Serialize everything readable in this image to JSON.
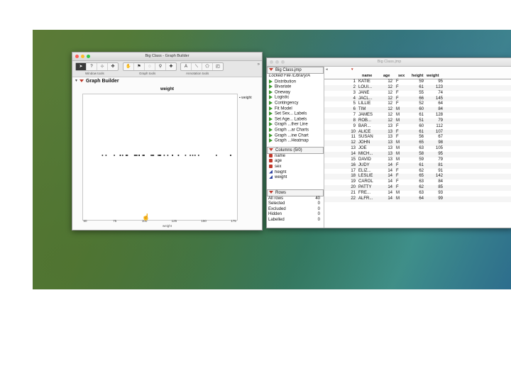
{
  "graph_window": {
    "title": "Big Class - Graph Builder",
    "toolbar_labels": [
      "Window tools",
      "Graph tools",
      "Annotation tools"
    ],
    "header": "Graph Builder",
    "plot_title": "weight",
    "legend_label": "weight",
    "x_axis_label": "weight",
    "x_ticks": [
      "50",
      "75",
      "100",
      "125",
      "150",
      "175"
    ]
  },
  "chart_data": {
    "type": "scatter",
    "title": "weight",
    "xlabel": "weight",
    "xlim": [
      50,
      175
    ],
    "values": [
      95,
      123,
      74,
      145,
      64,
      84,
      128,
      79,
      112,
      107,
      67,
      98,
      105,
      95,
      79,
      81,
      91,
      84,
      142,
      85,
      93,
      99,
      119,
      92,
      112,
      99,
      113,
      95,
      123,
      95,
      172,
      106,
      128,
      111,
      116,
      134,
      138,
      172,
      140,
      160
    ]
  },
  "table_window": {
    "title": "Big Class.jmp",
    "table_name": "Big Class.jmp",
    "locked_file": "Locked File",
    "locked_path": "/Library/A",
    "scripts": [
      "Distribution",
      "Bivariate",
      "Oneway",
      "Logistic",
      "Contingency",
      "Fit Model",
      "Set Sex... Labels",
      "Set Age... Labels",
      "Graph ...ther Line",
      "Graph ...ar Charts",
      "Graph ...ine Chart",
      "Graph ...Heatmap"
    ],
    "columns_header": "Columns (5/0)",
    "columns": [
      "name",
      "age",
      "sex",
      "height",
      "weight"
    ],
    "rows_header": "Rows",
    "row_stats": [
      {
        "label": "All rows",
        "value": "40"
      },
      {
        "label": "Selected",
        "value": "0"
      },
      {
        "label": "Excluded",
        "value": "0"
      },
      {
        "label": "Hidden",
        "value": "0"
      },
      {
        "label": "Labelled",
        "value": "0"
      }
    ],
    "grid_headers": [
      "name",
      "age",
      "sex",
      "height",
      "weight"
    ],
    "rows": [
      [
        "1",
        "KATIE",
        "12",
        "F",
        "59",
        "95"
      ],
      [
        "2",
        "LOUI...",
        "12",
        "F",
        "61",
        "123"
      ],
      [
        "3",
        "JANE",
        "12",
        "F",
        "55",
        "74"
      ],
      [
        "4",
        "JACL...",
        "12",
        "F",
        "66",
        "145"
      ],
      [
        "5",
        "LILLIE",
        "12",
        "F",
        "52",
        "64"
      ],
      [
        "6",
        "TIM",
        "12",
        "M",
        "60",
        "84"
      ],
      [
        "7",
        "JAMES",
        "12",
        "M",
        "61",
        "128"
      ],
      [
        "8",
        "ROB...",
        "12",
        "M",
        "51",
        "79"
      ],
      [
        "9",
        "BAR...",
        "13",
        "F",
        "60",
        "112"
      ],
      [
        "10",
        "ALICE",
        "13",
        "F",
        "61",
        "107"
      ],
      [
        "11",
        "SUSAN",
        "13",
        "F",
        "56",
        "67"
      ],
      [
        "12",
        "JOHN",
        "13",
        "M",
        "65",
        "98"
      ],
      [
        "13",
        "JOE",
        "13",
        "M",
        "63",
        "105"
      ],
      [
        "14",
        "MICH...",
        "13",
        "M",
        "58",
        "95"
      ],
      [
        "15",
        "DAVID",
        "13",
        "M",
        "59",
        "79"
      ],
      [
        "16",
        "JUDY",
        "14",
        "F",
        "61",
        "81"
      ],
      [
        "17",
        "ELIZ...",
        "14",
        "F",
        "62",
        "91"
      ],
      [
        "18",
        "LESLIE",
        "14",
        "F",
        "65",
        "142"
      ],
      [
        "19",
        "CAROL",
        "14",
        "F",
        "63",
        "84"
      ],
      [
        "20",
        "PATTY",
        "14",
        "F",
        "62",
        "85"
      ],
      [
        "21",
        "FRE...",
        "14",
        "M",
        "63",
        "93"
      ],
      [
        "22",
        "ALFR...",
        "14",
        "M",
        "64",
        "99"
      ]
    ]
  },
  "colors": {
    "traffic_close": "#fc5f57",
    "traffic_min": "#fdbc2e",
    "traffic_max": "#34c84a",
    "script_triangle": "#3d9a2f",
    "menu_triangle": "#c0392b",
    "nominal_icon": "#c0392b",
    "continuous_icon": "#2b3f9e"
  }
}
